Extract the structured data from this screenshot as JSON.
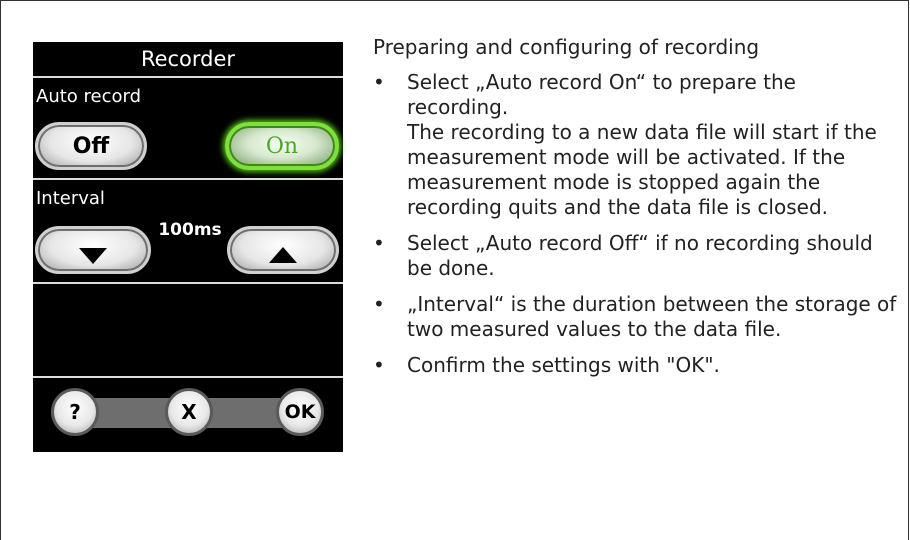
{
  "device": {
    "title": "Recorder",
    "auto_record_label": "Auto record",
    "off_label": "Off",
    "on_label": "On",
    "auto_record_selected": "On",
    "interval_label": "Interval",
    "interval_value": "100ms",
    "help_label": "?",
    "cancel_label": "X",
    "ok_label": "OK",
    "colors": {
      "active_glow": "#56c41c",
      "background": "#000000"
    }
  },
  "instructions": {
    "heading": "Preparing and configuring of recording",
    "bullets": [
      {
        "text": "Select „Auto record On“ to prepare the recording.",
        "extra": "The recording to a new data file will start if the measurement mode will be activated. If the measurement mode is stopped again the recording quits and the data file is closed."
      },
      {
        "text": "Select „Auto record Off“ if no recording should be done."
      },
      {
        "text": "„Interval“ is the duration between the storage of two measured values to the data file."
      },
      {
        "text": "Confirm the settings with \"OK\"."
      }
    ]
  }
}
